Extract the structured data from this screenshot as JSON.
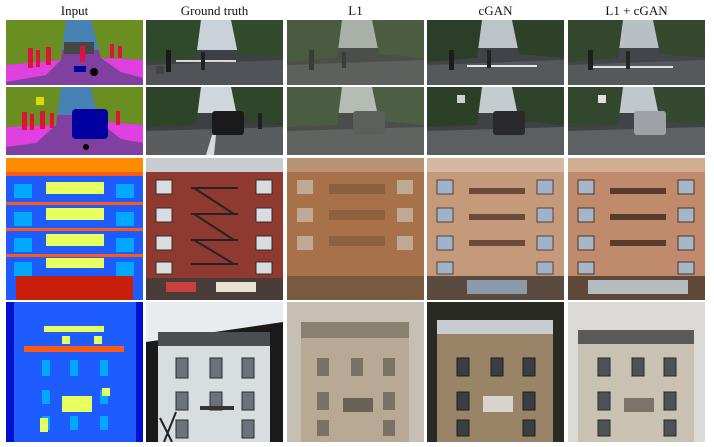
{
  "columns": [
    "Input",
    "Ground truth",
    "L1",
    "cGAN",
    "L1 + cGAN"
  ],
  "rows": [
    {
      "kind": "street label map and photos"
    },
    {
      "kind": "street label map and photos with car"
    },
    {
      "kind": "facade label map and photos"
    },
    {
      "kind": "facade label map and photos (house)"
    }
  ],
  "colors": {
    "label_road": "#8040a0",
    "label_sidewalk": "#e040e0",
    "label_vegetation": "#6b8e23",
    "label_sky": "#4682b4",
    "label_person": "#dc143c",
    "label_car": "#0000a0",
    "facade_background": "#0010d0",
    "facade_wall": "#1e5cff",
    "facade_window": "#00a8ff",
    "facade_balcony": "#e8ff60",
    "facade_cornice": "#ff5a14",
    "facade_shop": "#c81e0a"
  }
}
